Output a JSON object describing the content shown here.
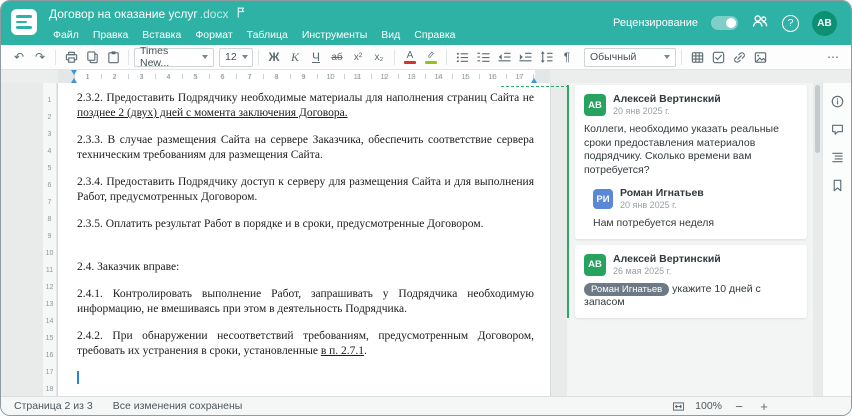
{
  "window": {
    "title": "Договор на оказание услуг",
    "title_ext": ".docx"
  },
  "header": {
    "menus": [
      "Файл",
      "Правка",
      "Вставка",
      "Формат",
      "Таблица",
      "Инструменты",
      "Вид",
      "Справка"
    ],
    "review_label": "Рецензирование",
    "user_initials": "АВ"
  },
  "toolbar": {
    "font_name": "Times New...",
    "font_size": "12",
    "style_name": "Обычный",
    "bold_label": "Ж",
    "italic_label": "К",
    "underline_label": "Ч",
    "strike_label": "аб",
    "superscript_label": "х²",
    "subscript_label": "х₂",
    "font_color_label": "А"
  },
  "icons": {
    "undo": "↶",
    "redo": "↷",
    "paragraph_mark": "¶",
    "more": "⋯",
    "zoom_out": "−",
    "zoom_in": "+"
  },
  "ruler": {
    "h_numbers": [
      "1",
      "2",
      "3",
      "4",
      "5",
      "6",
      "7",
      "8",
      "9",
      "10",
      "11",
      "12",
      "13",
      "14",
      "15",
      "16",
      "17"
    ],
    "v_numbers": [
      "1",
      "2",
      "3",
      "4",
      "5",
      "6",
      "7",
      "8",
      "9",
      "10",
      "11",
      "12",
      "13",
      "14",
      "15",
      "16",
      "17",
      "18"
    ]
  },
  "document": {
    "paragraphs": [
      {
        "text": "2.3.2. Предоставить Подрядчику необходимые материалы для наполнения страниц Сайта не ",
        "inserted": "позднее 2 (двух) дней с момента заключения Договора."
      },
      {
        "text": "2.3.3. В случае размещения Сайта на сервере Заказчика, обеспечить соответствие сервера техническим требованиям для размещения Сайта."
      },
      {
        "text": "2.3.4. Предоставить Подрядчику доступ к серверу для размещения Сайта и для выполнения Работ, предусмотренных Договором."
      },
      {
        "text": "2.3.5. Оплатить результат Работ в порядке и в сроки, предусмотренные Договором."
      },
      {
        "text": "2.4. Заказчик вправе:"
      },
      {
        "text": "2.4.1. Контролировать выполнение Работ, запрашивать у Подрядчика необходимую информацию, не вмешиваясь при этом в деятельность Подрядчика."
      },
      {
        "text": "2.4.2. При обнаружении несоответствий требованиям, предусмотренным Договором, требовать их устранения в сроки, установленные ",
        "inserted": "в п. 2.7.1",
        "text_after": "."
      }
    ]
  },
  "comments": {
    "items": [
      {
        "initials": "АВ",
        "author": "Алексей Вертинский",
        "date": "20 янв 2025 г.",
        "text": "Коллеги, необходимо указать реальные сроки предоставления материалов подрядчику. Сколько времени вам потребуется?",
        "reply": {
          "initials": "РИ",
          "author": "Роман Игнатьев",
          "date": "20 янв 2025 г.",
          "text": "Нам потребуется неделя"
        }
      },
      {
        "initials": "АВ",
        "author": "Алексей Вертинский",
        "date": "26 мая 2025 г.",
        "mention": "Роман Игнатьев",
        "text": "укажите 10 дней с запасом"
      }
    ]
  },
  "statusbar": {
    "page_info": "Страница 2 из 3",
    "save_status": "Все изменения сохранены",
    "zoom": "100%"
  },
  "colors": {
    "header": "#2fb2a6",
    "accent": "#2fb2a6",
    "change_green": "#2aa967",
    "avatar_green": "#27a35f",
    "avatar_blue": "#5b87d7",
    "avatar_user": "#0f8f71",
    "mention_bg": "#6d7a85",
    "caret_blue": "#2f7fd4",
    "marker_blue": "#3b97d3",
    "font_color_bar": "#d0342c",
    "highlight_bar": "#95c11f"
  }
}
